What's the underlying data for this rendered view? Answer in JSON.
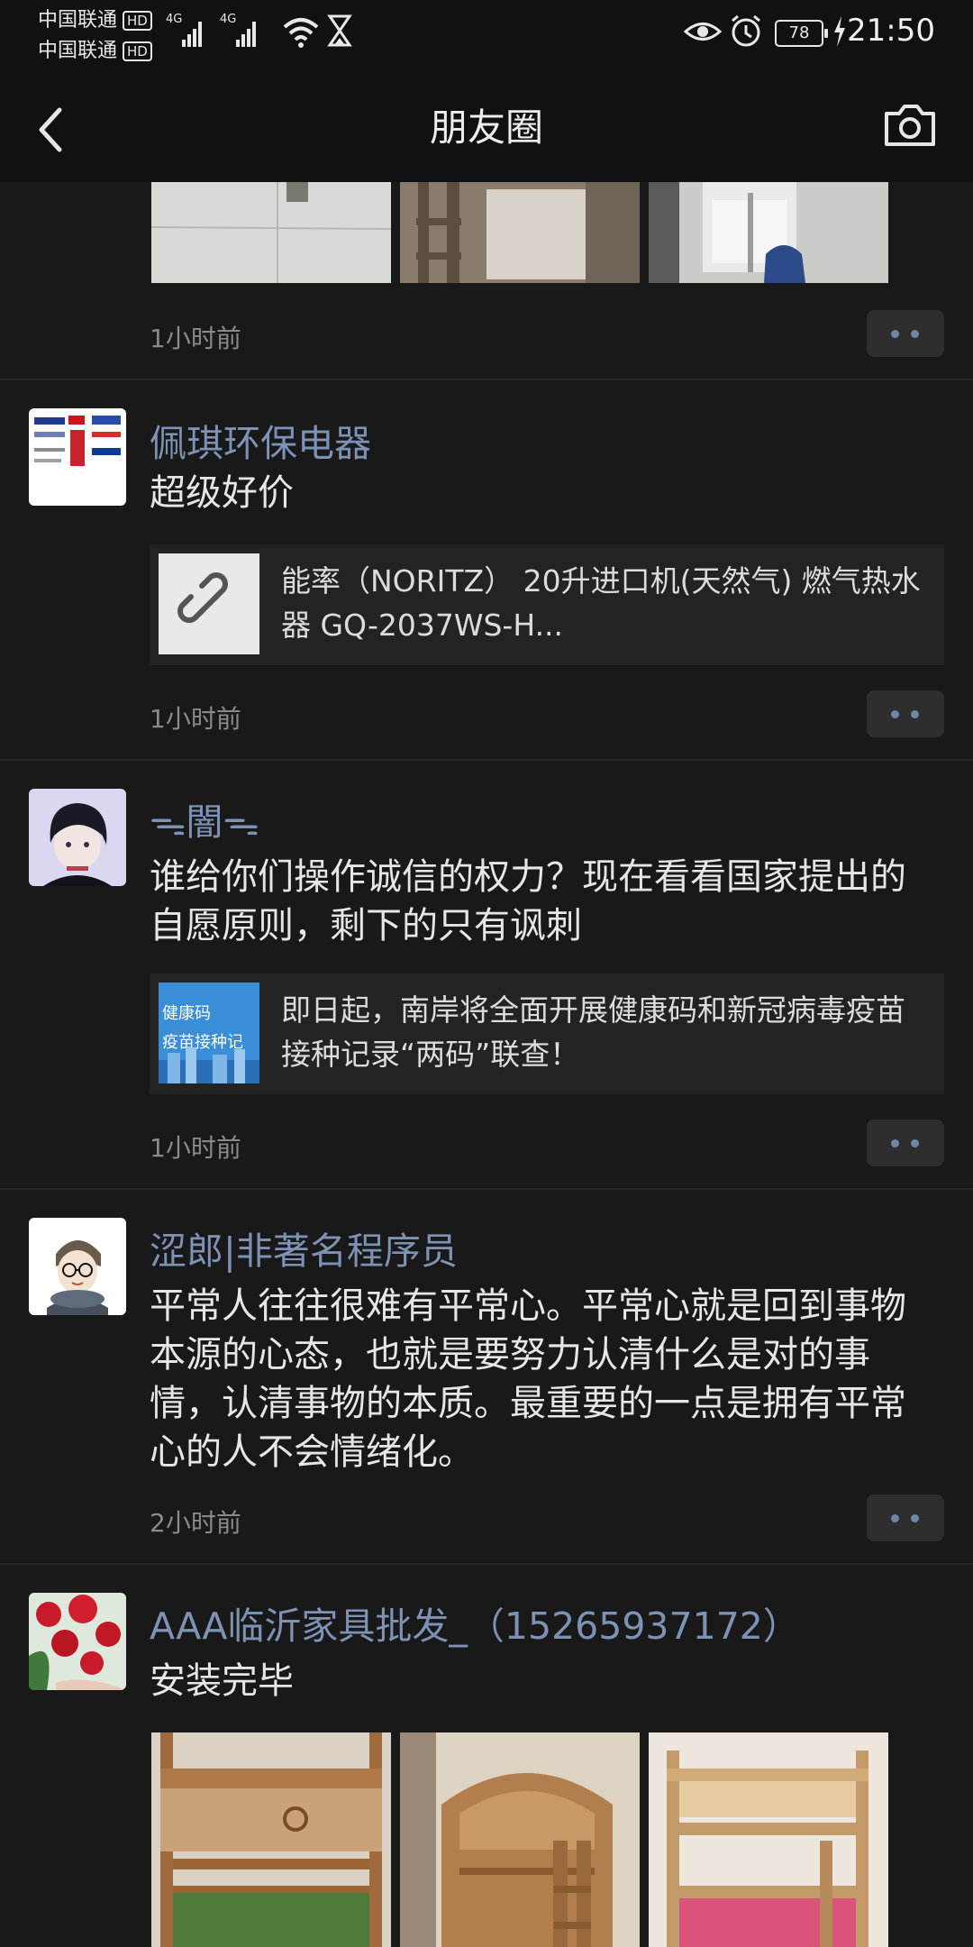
{
  "status_bar": {
    "carrier1": "中国联通",
    "carrier2": "中国联通",
    "hd1": "HD",
    "hd2": "HD",
    "net1": "4G",
    "net2": "4G",
    "battery": "78",
    "time": "21:50"
  },
  "nav": {
    "title": "朋友圈"
  },
  "posts": [
    {
      "time": "1小时前"
    },
    {
      "name": "佩琪环保电器",
      "text": "超级好价",
      "link_text": "能率（NORITZ） 20升进口机(天然气) 燃气热水器 GQ-2037WS-H...",
      "time": "1小时前"
    },
    {
      "name": "ᯓ闇ᯓ",
      "text": "谁给你们操作诚信的权力？现在看看国家提出的自愿原则，剩下的只有讽刺",
      "link_thumb_text1": "健康码",
      "link_thumb_text2": "疫苗接种记",
      "link_text": "即日起，南岸将全面开展健康码和新冠病毒疫苗接种记录“两码”联查！",
      "time": "1小时前"
    },
    {
      "name": "涩郎|非著名程序员",
      "text": "平常人往往很难有平常心。平常心就是回到事物本源的心态，也就是要努力认清什么是对的事情，认清事物的本质。最重要的一点是拥有平常心的人不会情绪化。",
      "time": "2小时前"
    },
    {
      "name": "AAA临沂家具批发_（15265937172）",
      "text": "安装完毕"
    }
  ],
  "colors": {
    "background": "#191919",
    "bar": "#111111",
    "name": "#7d92b5",
    "card": "#232323"
  }
}
